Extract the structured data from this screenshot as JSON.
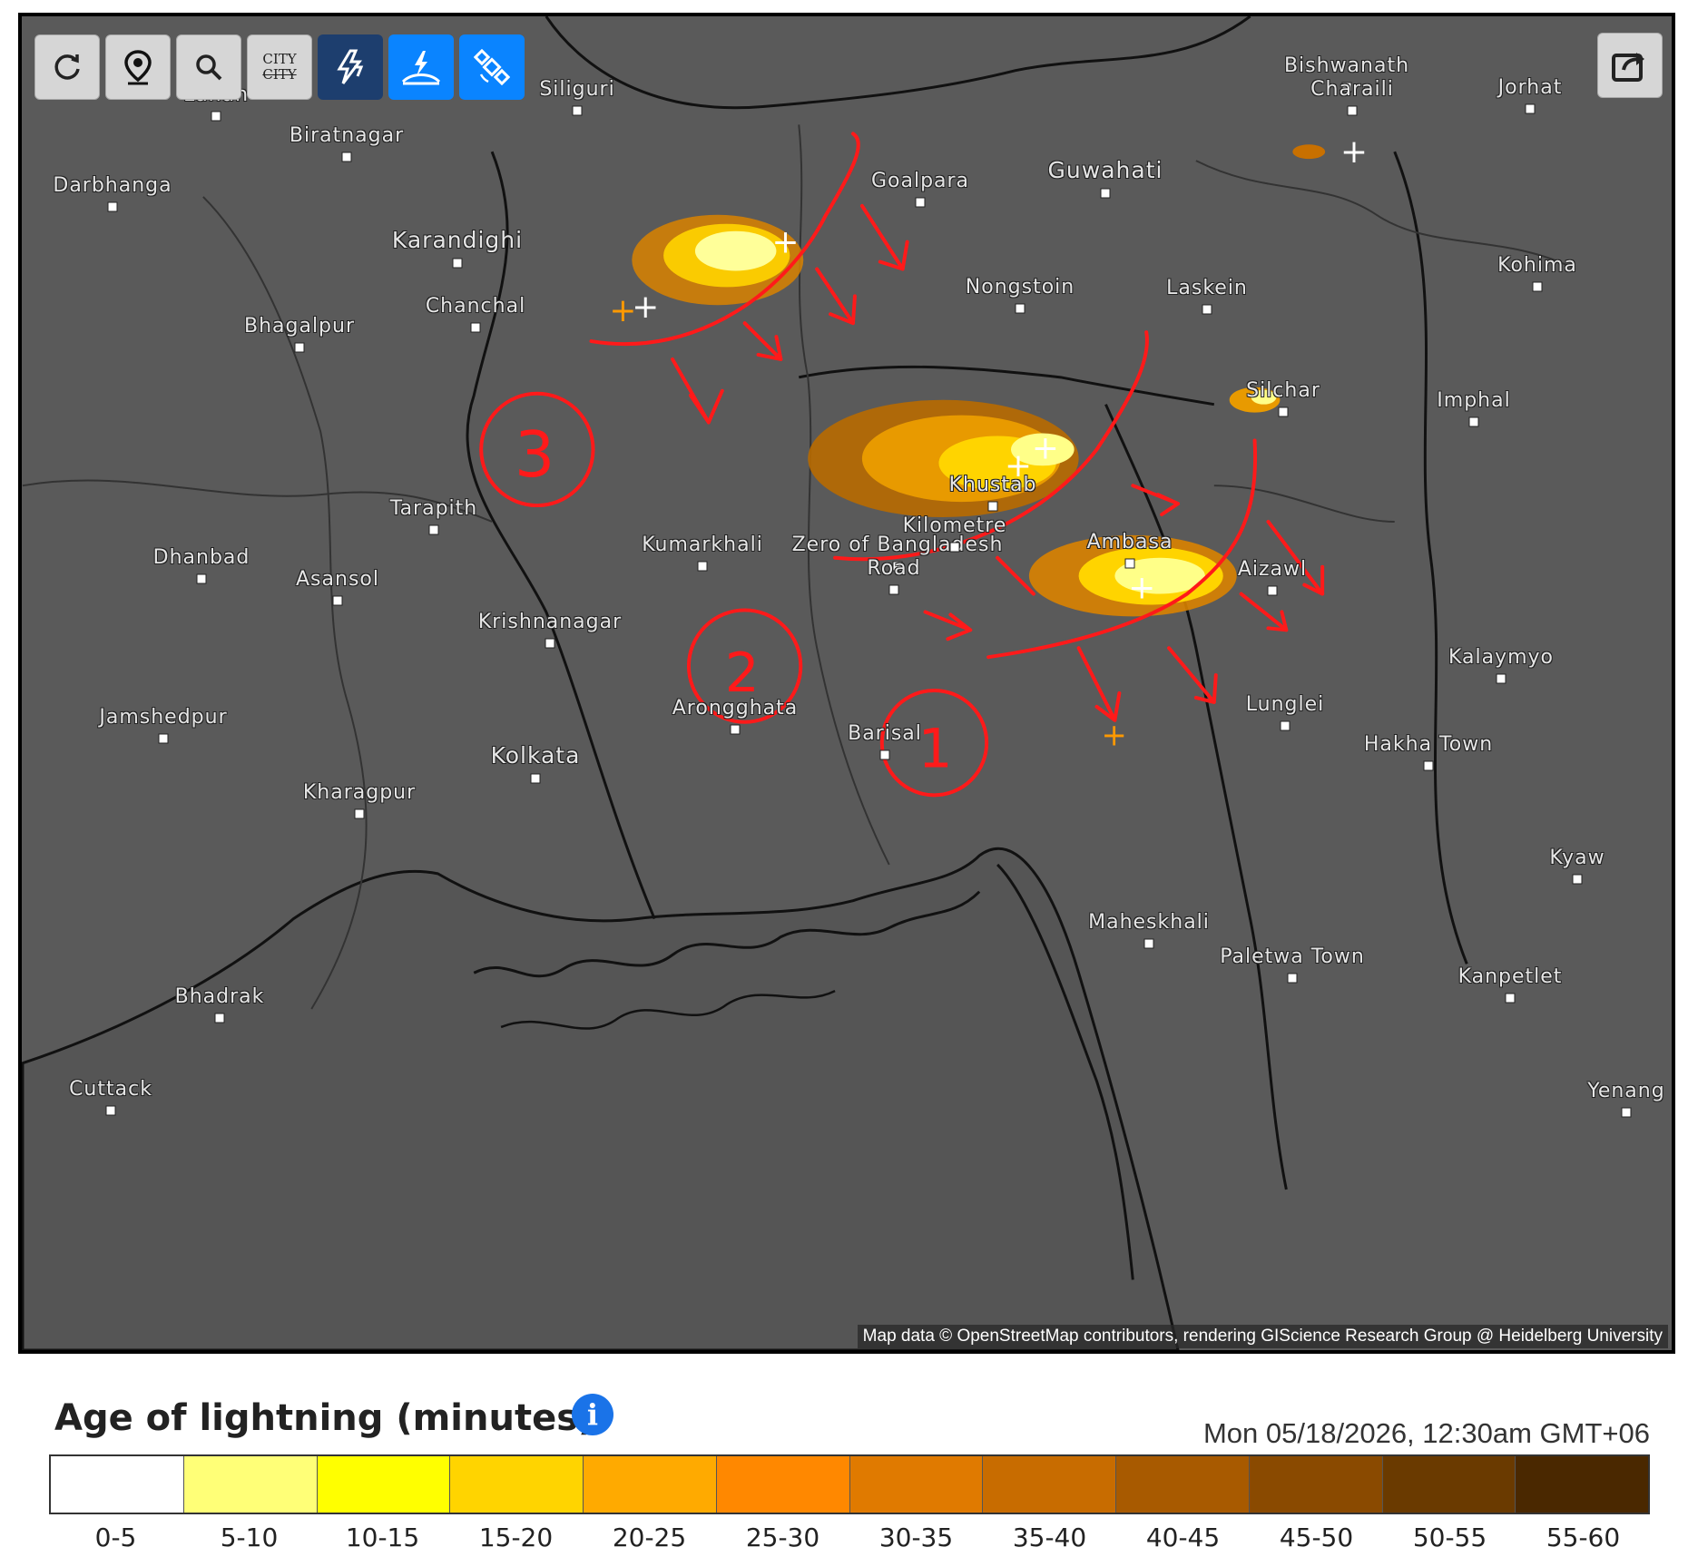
{
  "toolbar": {
    "buttons": [
      {
        "name": "refresh-button",
        "icon": "refresh-icon"
      },
      {
        "name": "location-button",
        "icon": "map-pin-icon"
      },
      {
        "name": "zoom-button",
        "icon": "zoom-icon"
      },
      {
        "name": "city-labels-toggle",
        "icon": "city-strike-icon",
        "label": "CITY",
        "label_strike": "CITY"
      },
      {
        "name": "lightning-layer-toggle",
        "icon": "lightning-icon"
      },
      {
        "name": "ground-strike-toggle",
        "icon": "ground-strike-icon"
      },
      {
        "name": "satellite-toggle",
        "icon": "satellite-icon"
      }
    ],
    "share_icon": "share-icon"
  },
  "cities": [
    {
      "name": "Siliguri"
    },
    {
      "name": "Lahan"
    },
    {
      "name": "Biratnagar"
    },
    {
      "name": "Darbhanga"
    },
    {
      "name": "Karandighi"
    },
    {
      "name": "Chanchal"
    },
    {
      "name": "Bhagalpur"
    },
    {
      "name": "Goalpara"
    },
    {
      "name": "Guwahati"
    },
    {
      "name": "Bishwanath"
    },
    {
      "name": "Charaili"
    },
    {
      "name": "Jorhat"
    },
    {
      "name": "Kohima"
    },
    {
      "name": "Nongstoin"
    },
    {
      "name": "Laskein"
    },
    {
      "name": "Silchar"
    },
    {
      "name": "Imphal"
    },
    {
      "name": "Tarapith"
    },
    {
      "name": "Dhanbad"
    },
    {
      "name": "Asansol"
    },
    {
      "name": "Kumarkhali"
    },
    {
      "name": "Zero of Bangladesh"
    },
    {
      "name": "Road"
    },
    {
      "name": "Aizawl"
    },
    {
      "name": "Krishnanagar"
    },
    {
      "name": "Kalaymyo"
    },
    {
      "name": "Jamshedpur"
    },
    {
      "name": "Arongghata"
    },
    {
      "name": "Barisal"
    },
    {
      "name": "Lunglei"
    },
    {
      "name": "Hakha Town"
    },
    {
      "name": "Kolkata"
    },
    {
      "name": "Kharagpur"
    },
    {
      "name": "Kyaw"
    },
    {
      "name": "Maheskhali"
    },
    {
      "name": "Paletwa Town"
    },
    {
      "name": "Kanpetlet"
    },
    {
      "name": "Bhadrak"
    },
    {
      "name": "Cuttack"
    },
    {
      "name": "Yenang"
    },
    {
      "name": "Kilometre"
    },
    {
      "name": "Ambasa"
    },
    {
      "name": "Khustab"
    }
  ],
  "annotations": [
    "3",
    "2",
    "1"
  ],
  "attribution": "Map data © OpenStreetMap contributors, rendering GIScience Research Group @ Heidelberg University",
  "legend": {
    "title": "Age of lightning (minutes)",
    "info_icon": "i",
    "timestamp": "Mon 05/18/2026, 12:30am GMT+06",
    "bins": [
      {
        "label": "0-5",
        "color": "#ffffff"
      },
      {
        "label": "5-10",
        "color": "#ffff77"
      },
      {
        "label": "10-15",
        "color": "#ffff00"
      },
      {
        "label": "15-20",
        "color": "#ffd400"
      },
      {
        "label": "20-25",
        "color": "#ffaa00"
      },
      {
        "label": "25-30",
        "color": "#ff8800"
      },
      {
        "label": "30-35",
        "color": "#e07a00"
      },
      {
        "label": "35-40",
        "color": "#c86c00"
      },
      {
        "label": "40-45",
        "color": "#a85a00"
      },
      {
        "label": "45-50",
        "color": "#8a4a00"
      },
      {
        "label": "50-55",
        "color": "#6a3a00"
      },
      {
        "label": "55-60",
        "color": "#4a2800"
      }
    ]
  }
}
